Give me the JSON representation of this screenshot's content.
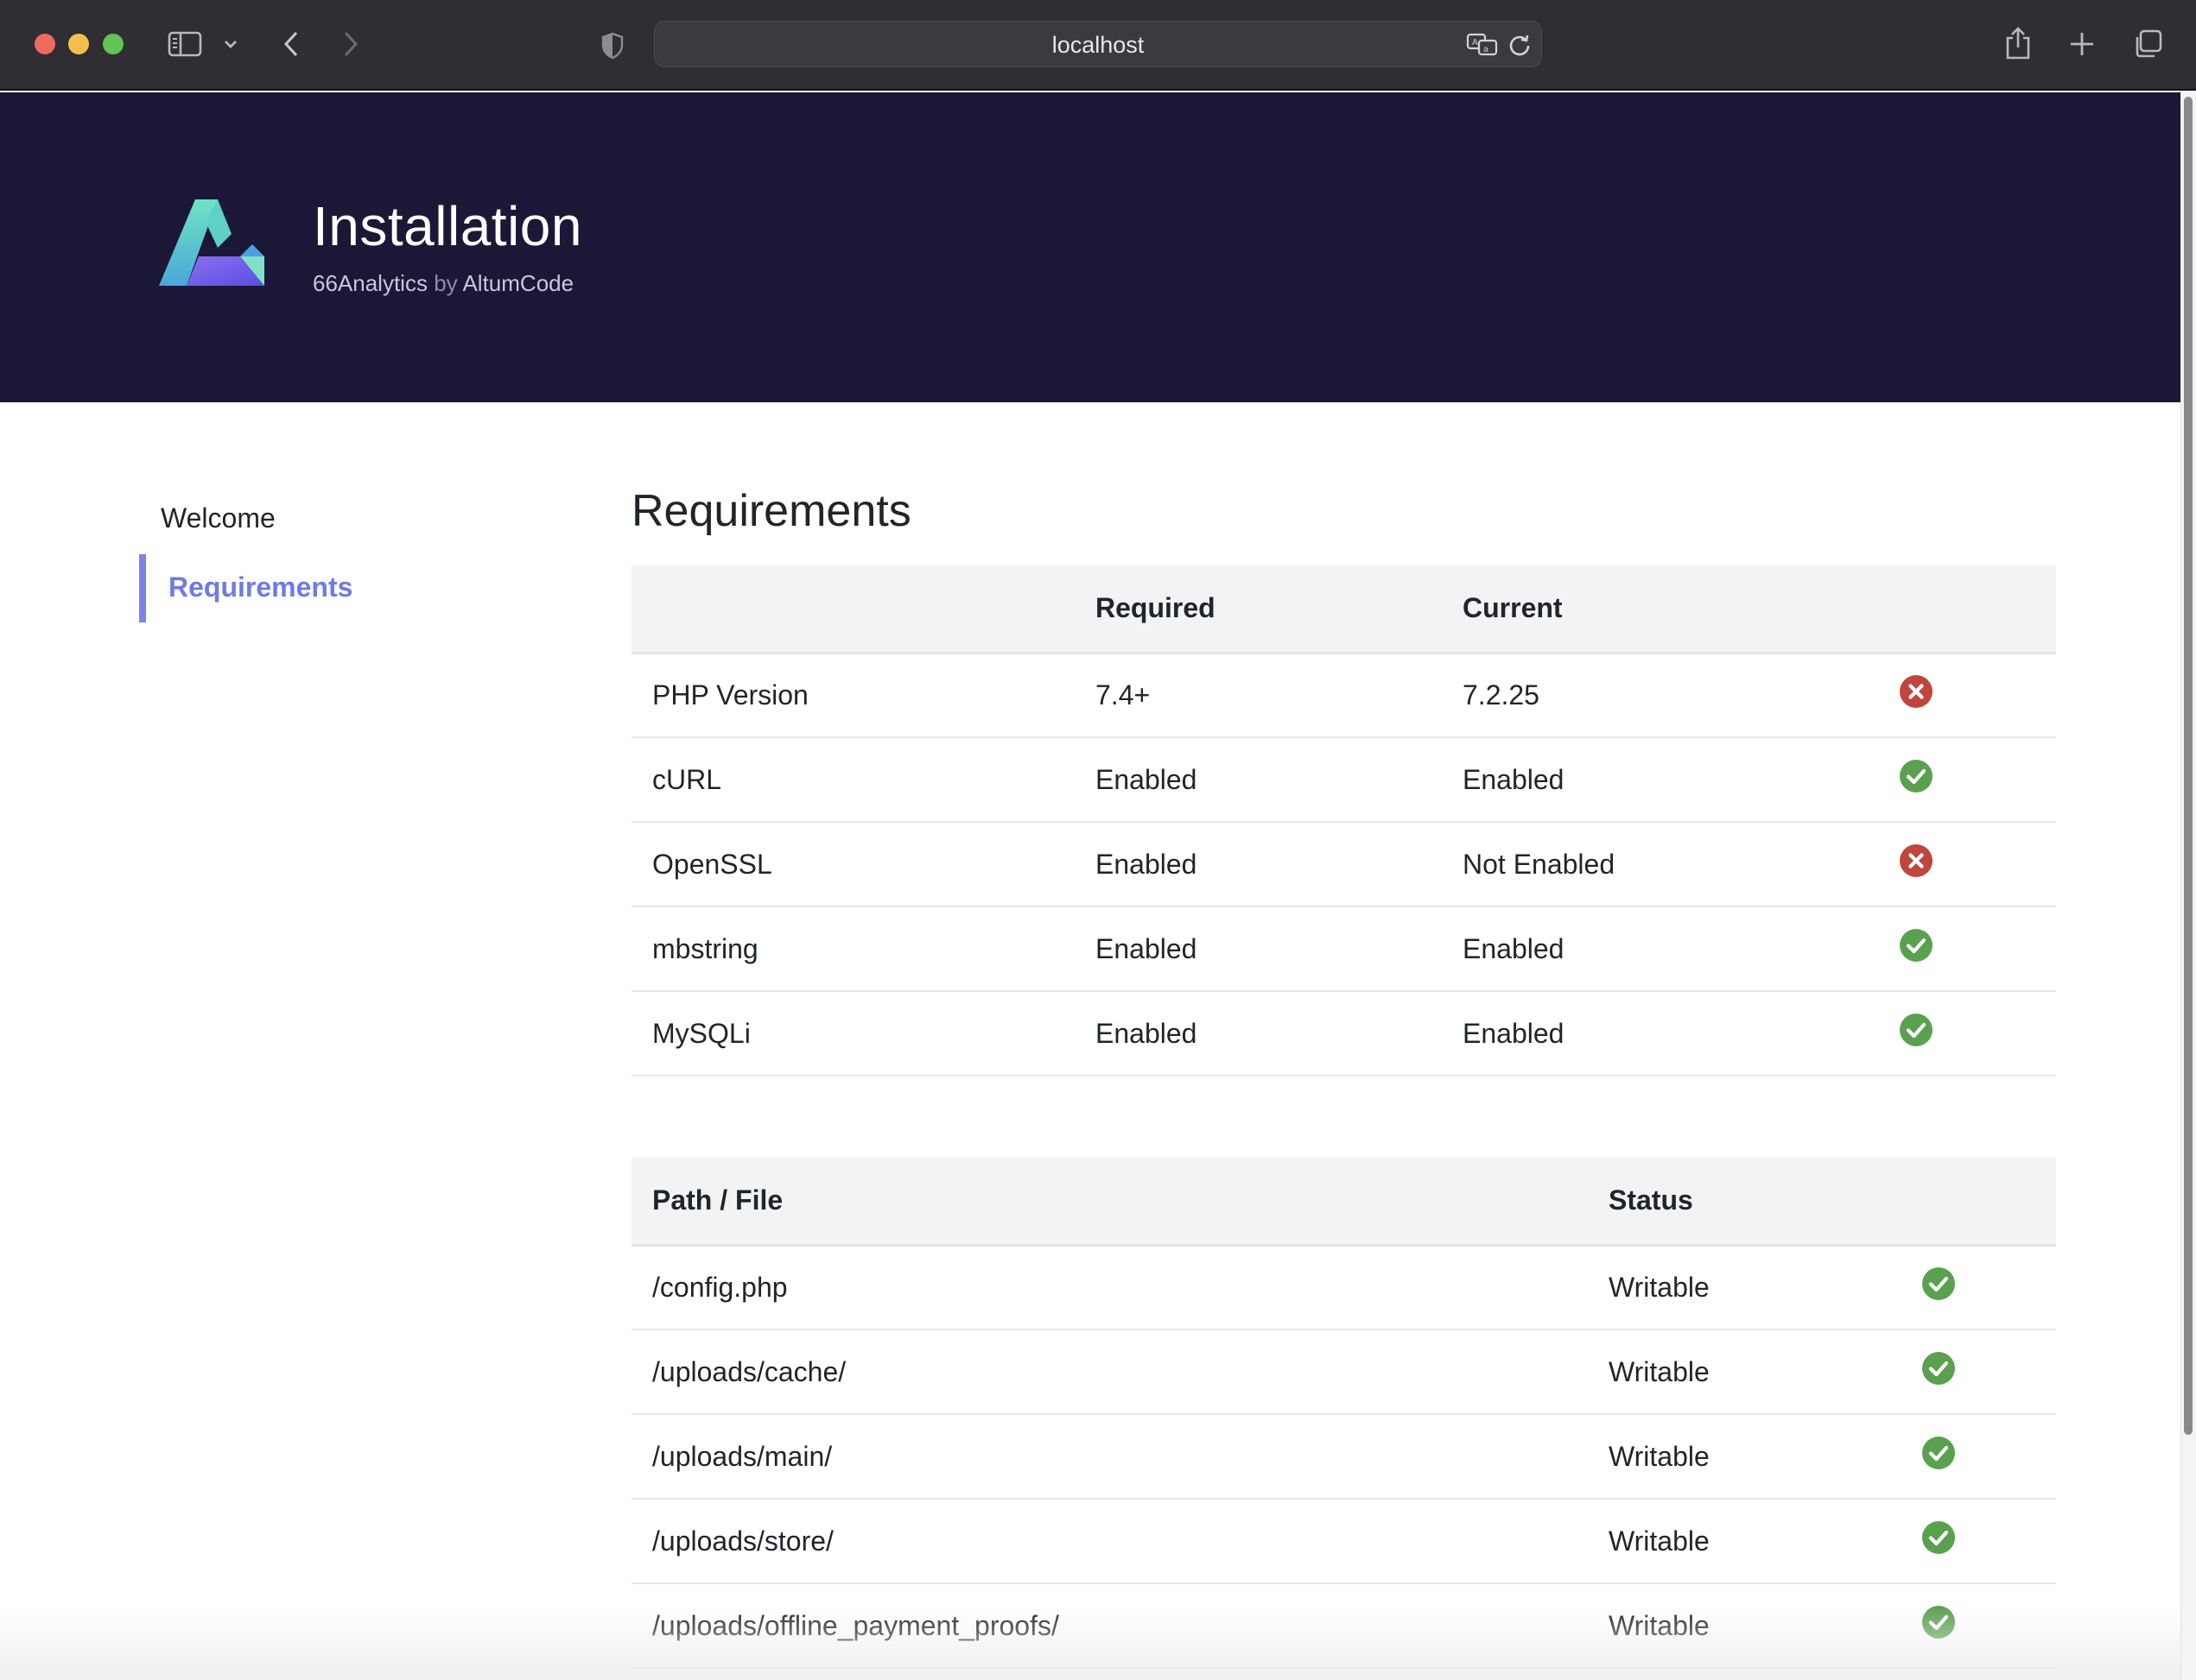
{
  "browser": {
    "url": "localhost",
    "icons": {
      "sidebar": "sidebar-toggle-icon",
      "chevron": "chevron-down-icon",
      "back": "back-arrow-icon",
      "forward": "forward-arrow-icon",
      "privacy": "privacy-shield-icon",
      "translate": "translate-icon",
      "reload": "reload-icon",
      "share": "share-icon",
      "new_tab": "plus-icon",
      "tabs": "tab-overview-icon"
    }
  },
  "header": {
    "title": "Installation",
    "product": "66Analytics",
    "by": "by",
    "vendor": "AltumCode"
  },
  "sidebar": {
    "items": [
      {
        "label": "Welcome",
        "active": false
      },
      {
        "label": "Requirements",
        "active": true
      }
    ]
  },
  "main": {
    "title": "Requirements",
    "requirements_table": {
      "headers": [
        "",
        "Required",
        "Current",
        ""
      ],
      "rows": [
        {
          "name": "PHP Version",
          "required": "7.4+",
          "current": "7.2.25",
          "ok": false
        },
        {
          "name": "cURL",
          "required": "Enabled",
          "current": "Enabled",
          "ok": true
        },
        {
          "name": "OpenSSL",
          "required": "Enabled",
          "current": "Not Enabled",
          "ok": false
        },
        {
          "name": "mbstring",
          "required": "Enabled",
          "current": "Enabled",
          "ok": true
        },
        {
          "name": "MySQLi",
          "required": "Enabled",
          "current": "Enabled",
          "ok": true
        }
      ]
    },
    "paths_table": {
      "headers": [
        "Path / File",
        "Status",
        ""
      ],
      "rows": [
        {
          "path": "/config.php",
          "status": "Writable",
          "ok": true
        },
        {
          "path": "/uploads/cache/",
          "status": "Writable",
          "ok": true
        },
        {
          "path": "/uploads/main/",
          "status": "Writable",
          "ok": true
        },
        {
          "path": "/uploads/store/",
          "status": "Writable",
          "ok": true
        },
        {
          "path": "/uploads/offline_payment_proofs/",
          "status": "Writable",
          "ok": true
        }
      ]
    }
  },
  "colors": {
    "hero_bg": "#1b1837",
    "accent": "#6e7be5",
    "success": "#5aa14f",
    "error": "#c0453c"
  }
}
